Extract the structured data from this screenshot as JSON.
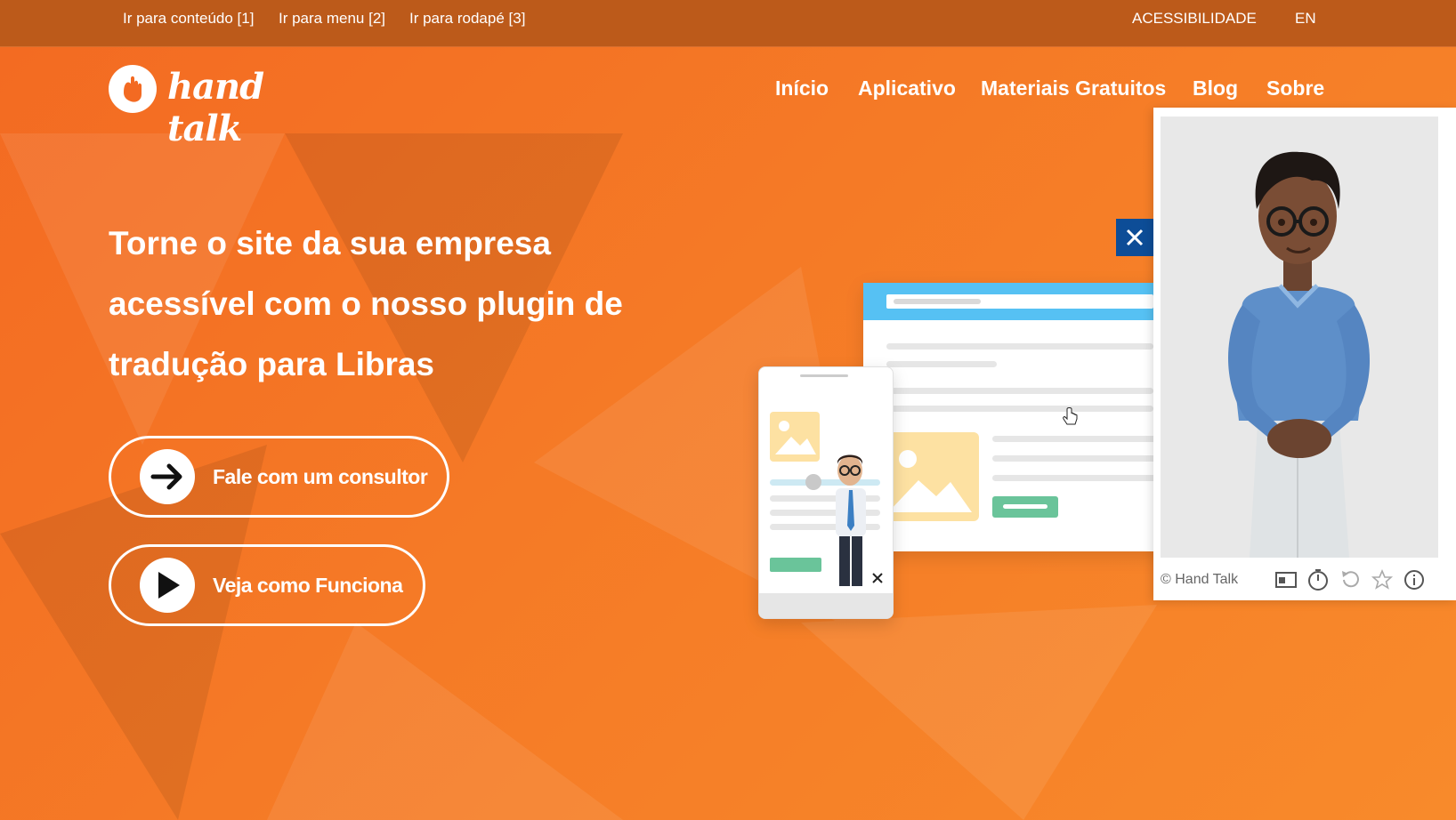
{
  "skip_links": [
    {
      "label": "Ir para conteúdo [1]"
    },
    {
      "label": "Ir para menu [2]"
    },
    {
      "label": "Ir para rodapé [3]"
    }
  ],
  "topbar": {
    "accessibility": "ACESSIBILIDADE",
    "language": "EN"
  },
  "brand": {
    "name": "hand talk"
  },
  "nav": [
    {
      "label": "Início"
    },
    {
      "label": "Aplicativo"
    },
    {
      "label": "Materiais Gratuitos"
    },
    {
      "label": "Blog"
    },
    {
      "label": "Sobre"
    }
  ],
  "hero": {
    "title": "Torne o site da sua empresa acessível com o nosso plugin de tradução para Libras",
    "cta_primary": "Fale com um consultor",
    "cta_secondary": "Veja como Funciona"
  },
  "widget": {
    "copyright": "© Hand Talk",
    "icons": [
      "window-mode-icon",
      "speed-icon",
      "replay-icon",
      "star-icon",
      "info-icon"
    ]
  },
  "colors": {
    "primary": "#f36a22",
    "topbar": "#bc5a1a",
    "close_button": "#0d4d97",
    "browser_bar": "#56c1f3"
  }
}
